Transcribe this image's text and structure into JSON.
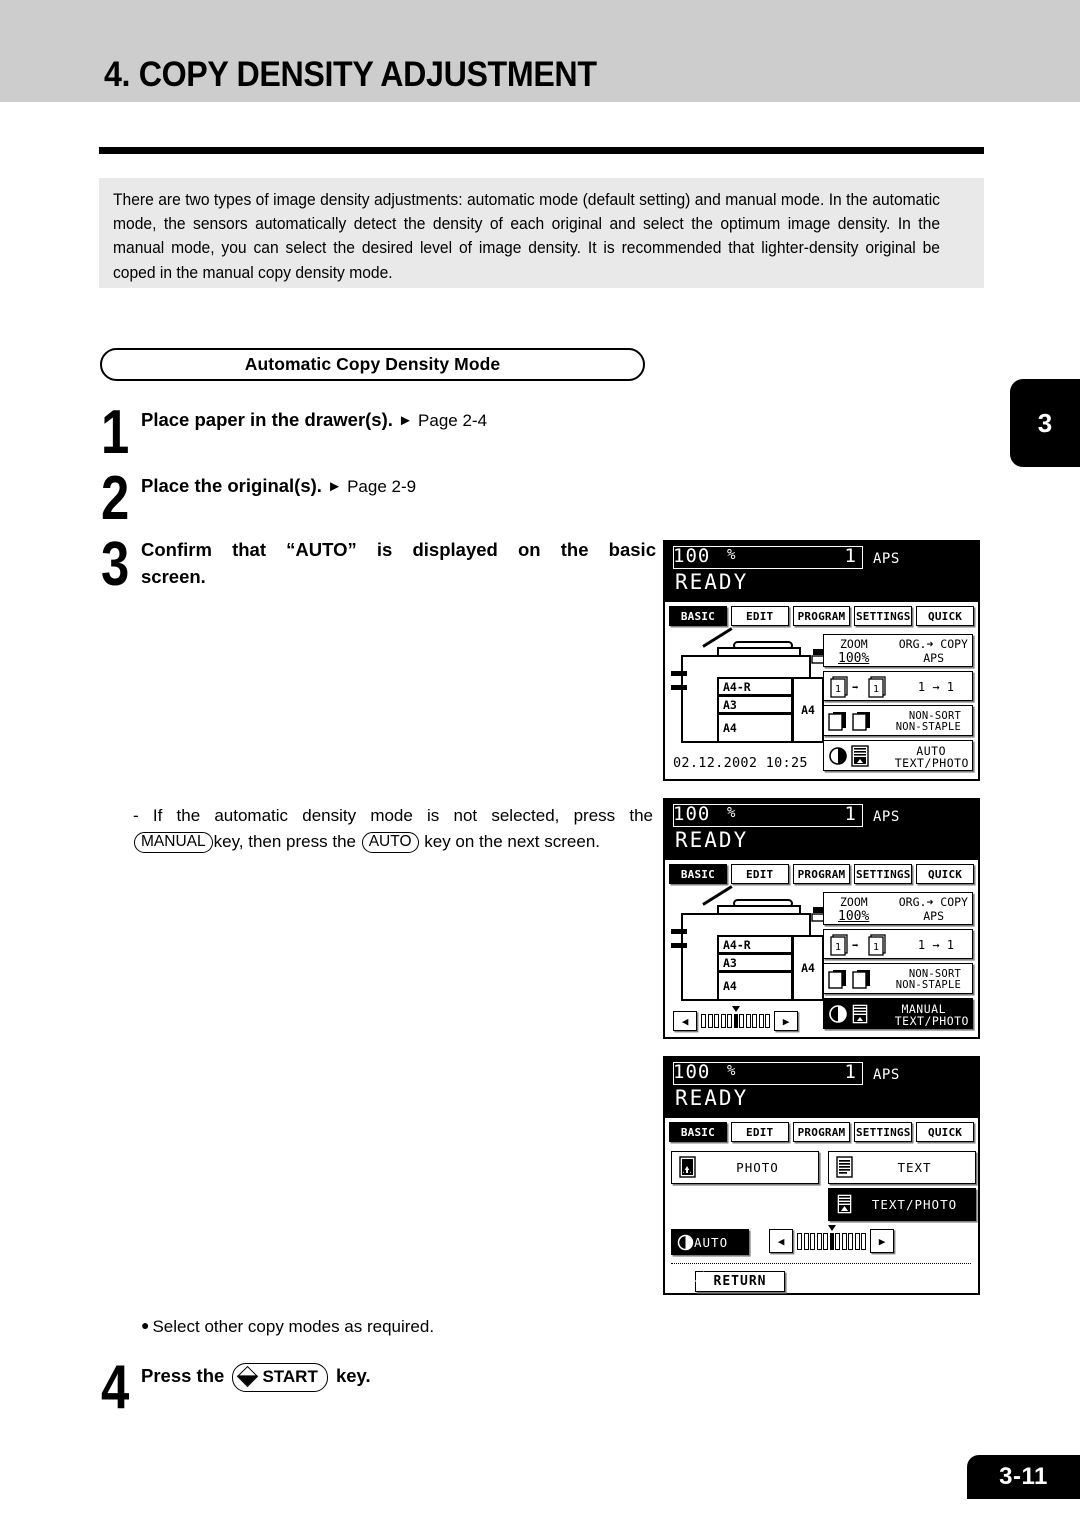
{
  "header": {
    "chapter_title": "4. COPY DENSITY ADJUSTMENT",
    "side_tab_number": "3",
    "page_number": "3-11"
  },
  "intro": {
    "paragraph": "There are two types of image density adjustments: automatic mode (default setting) and manual mode. In the automatic mode, the sensors automatically detect the density of each original and select the optimum image density. In the manual mode, you can select the desired level of image density. It is recommended that lighter-density original be coped in the manual copy density mode."
  },
  "section": {
    "pill_title": "Automatic Copy Density Mode"
  },
  "steps": [
    {
      "number": "1",
      "text": "Place paper in the drawer(s).",
      "arrow": "►",
      "page_ref": "Page 2-4"
    },
    {
      "number": "2",
      "text": "Place the original(s).",
      "arrow": "►",
      "page_ref": "Page 2-9"
    },
    {
      "number": "3",
      "line1": "Confirm that “AUTO” is displayed on the basic",
      "line2": "screen."
    },
    {
      "number": "4",
      "prefix": "Press the",
      "key_label": "START",
      "suffix": "key."
    }
  ],
  "note": {
    "dash": "-",
    "line1": "If the automatic density mode is not selected, press the",
    "key1": "MANUAL",
    "mid": "key, then press the",
    "key2": "AUTO",
    "tail": "key on the next screen."
  },
  "bullet": {
    "marker": "●",
    "text": "Select other copy modes as required."
  },
  "lcd_common": {
    "zoom_value": "100",
    "percent_sign": "%",
    "copy_count": "1",
    "paper_mode": "APS",
    "status": "READY",
    "tabs": [
      {
        "label": "BASIC",
        "selected": true
      },
      {
        "label": "EDIT",
        "selected": false
      },
      {
        "label": "PROGRAM",
        "selected": false
      },
      {
        "label": "SETTINGS",
        "selected": false
      },
      {
        "label": "QUICK",
        "selected": false
      }
    ]
  },
  "panel1": {
    "date_time": "02.12.2002 10:25",
    "drawers": {
      "drawer1": "A4-R",
      "drawer2": "A3",
      "drawer3": "A4",
      "bypass": "A4"
    },
    "options": {
      "zoom_label": "ZOOM",
      "zoom_value": "100%",
      "org_copy": "ORG.➜ COPY",
      "org_copy_value": "APS",
      "duplex": "1 → 1",
      "finish_line1": "NON-SORT",
      "finish_line2": "NON-STAPLE",
      "density_line1": "AUTO",
      "density_line2": "TEXT/PHOTO"
    }
  },
  "panel2": {
    "drawers": {
      "drawer1": "A4-R",
      "drawer2": "A3",
      "drawer3": "A4",
      "bypass": "A4"
    },
    "options": {
      "zoom_label": "ZOOM",
      "zoom_value": "100%",
      "org_copy": "ORG.➜ COPY",
      "org_copy_value": "APS",
      "duplex": "1 → 1",
      "finish_line1": "NON-SORT",
      "finish_line2": "NON-STAPLE",
      "density_line1": "MANUAL",
      "density_line2": "TEXT/PHOTO"
    },
    "slider": {
      "left_arrow": "◀",
      "right_arrow": "▶",
      "ticks": 11,
      "position": 6
    }
  },
  "panel3": {
    "modes": [
      {
        "label": "PHOTO",
        "selected": false
      },
      {
        "label": "TEXT",
        "selected": false
      },
      {
        "label": "TEXT/PHOTO",
        "selected": true
      }
    ],
    "auto_button": "AUTO",
    "return_button": "RETURN",
    "slider": {
      "left_arrow": "◀",
      "right_arrow": "▶",
      "ticks": 11,
      "position": 6
    }
  },
  "colors": {
    "header_band": "#cdcdcd",
    "intro_box": "#e9e9e9",
    "ink": "#000000",
    "paper": "#ffffff",
    "lcd_shadow": "#7d7d7d"
  }
}
